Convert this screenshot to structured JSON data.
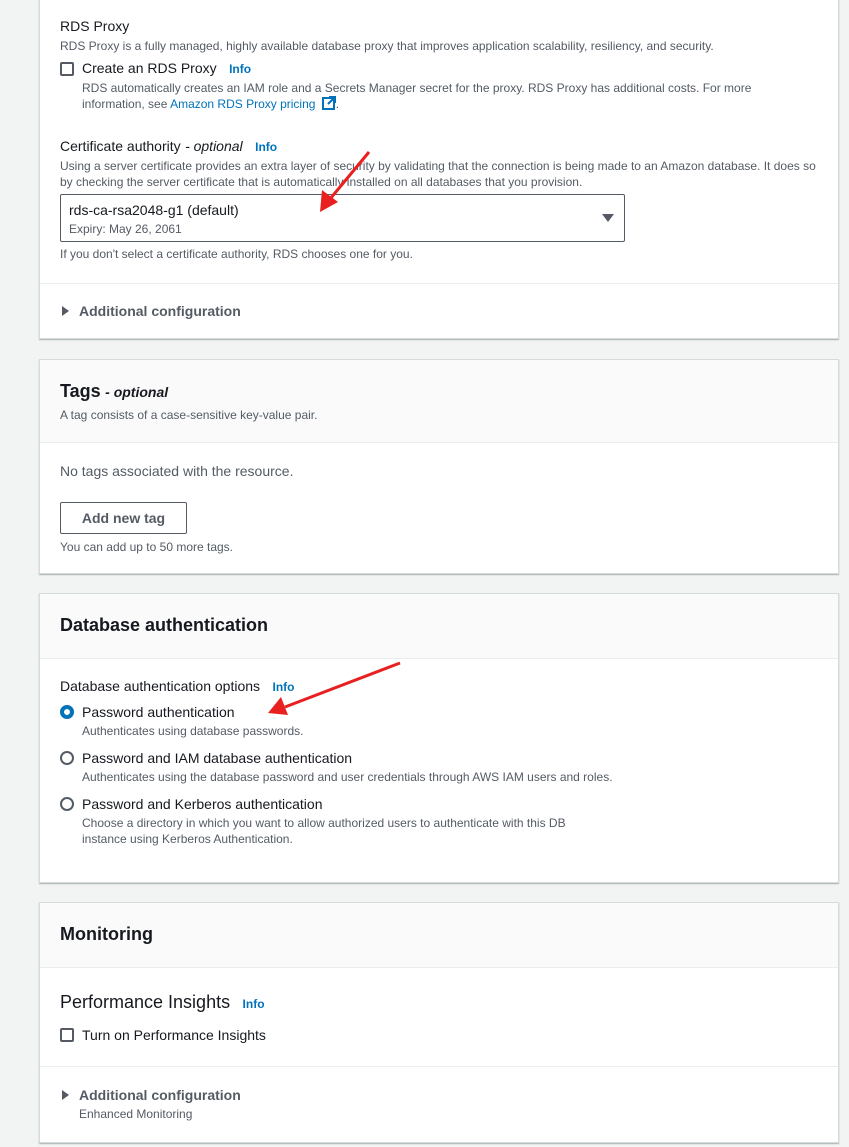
{
  "top_panel": {
    "rds_proxy": {
      "heading": "RDS Proxy",
      "description": "RDS Proxy is a fully managed, highly available database proxy that improves application scalability, resiliency, and security.",
      "checkbox_label": "Create an RDS Proxy",
      "info": "Info",
      "note_part1": "RDS automatically creates an IAM role and a Secrets Manager secret for the proxy. RDS Proxy has additional costs. For more information, see ",
      "note_link": "Amazon RDS Proxy pricing",
      "note_end": "."
    },
    "certificate_authority": {
      "label": "Certificate authority",
      "optional": "- optional",
      "info": "Info",
      "description": "Using a server certificate provides an extra layer of security by validating that the connection is being made to an Amazon database. It does so by checking the server certificate that is automatically installed on all databases that you provision.",
      "selected_value": "rds-ca-rsa2048-g1 (default)",
      "selected_sub": "Expiry: May 26, 2061",
      "hint": "If you don't select a certificate authority, RDS chooses one for you."
    },
    "additional_configuration": "Additional configuration"
  },
  "tags_panel": {
    "title": "Tags",
    "title_optional": "- optional",
    "description": "A tag consists of a case-sensitive key-value pair.",
    "empty_text": "No tags associated with the resource.",
    "add_button": "Add new tag",
    "hint": "You can add up to 50 more tags."
  },
  "auth_panel": {
    "title": "Database authentication",
    "options_label": "Database authentication options",
    "info": "Info",
    "options": [
      {
        "label": "Password authentication",
        "description": "Authenticates using database passwords.",
        "selected": true
      },
      {
        "label": "Password and IAM database authentication",
        "description": "Authenticates using the database password and user credentials through AWS IAM users and roles.",
        "selected": false
      },
      {
        "label": "Password and Kerberos authentication",
        "description_line1": "Choose a directory in which you want to allow authorized users to authenticate with this DB",
        "description_line2": "instance using Kerberos Authentication.",
        "selected": false
      }
    ]
  },
  "monitoring_panel": {
    "title": "Monitoring",
    "performance_insights": {
      "heading": "Performance Insights",
      "info": "Info",
      "checkbox_label": "Turn on Performance Insights"
    },
    "additional_configuration": "Additional configuration",
    "additional_sub": "Enhanced Monitoring"
  },
  "colors": {
    "accent": "#0073bb",
    "annotation_arrow": "#e8201f"
  }
}
